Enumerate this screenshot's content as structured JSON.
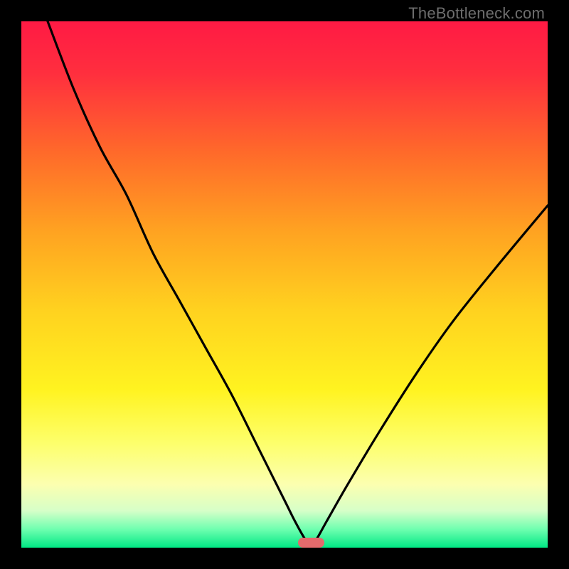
{
  "watermark": "TheBottleneck.com",
  "colors": {
    "frame": "#000000",
    "curve": "#000000",
    "marker": "#e46a6c",
    "gradient_stops": [
      {
        "pos": 0.0,
        "color": "#ff1a44"
      },
      {
        "pos": 0.1,
        "color": "#ff2f3e"
      },
      {
        "pos": 0.25,
        "color": "#ff6a2a"
      },
      {
        "pos": 0.4,
        "color": "#ffa321"
      },
      {
        "pos": 0.55,
        "color": "#ffd21f"
      },
      {
        "pos": 0.7,
        "color": "#fff320"
      },
      {
        "pos": 0.8,
        "color": "#fdff6a"
      },
      {
        "pos": 0.88,
        "color": "#fcffb0"
      },
      {
        "pos": 0.93,
        "color": "#d6ffc8"
      },
      {
        "pos": 0.965,
        "color": "#6fffb0"
      },
      {
        "pos": 1.0,
        "color": "#00e884"
      }
    ]
  },
  "chart_data": {
    "type": "line",
    "title": "",
    "xlabel": "",
    "ylabel": "",
    "xlim": [
      0,
      100
    ],
    "ylim": [
      0,
      100
    ],
    "series": [
      {
        "name": "bottleneck-curve",
        "x": [
          5,
          10,
          15,
          20,
          25,
          30,
          35,
          40,
          45,
          50,
          52,
          54,
          55,
          56,
          58,
          62,
          68,
          75,
          82,
          90,
          100
        ],
        "values": [
          100,
          87,
          76,
          67,
          56,
          47,
          38,
          29,
          19,
          9,
          5,
          1.5,
          1,
          1.5,
          5,
          12,
          22,
          33,
          43,
          53,
          65
        ]
      }
    ],
    "marker": {
      "x_start": 52.5,
      "x_end": 57.5,
      "y": 1
    }
  }
}
